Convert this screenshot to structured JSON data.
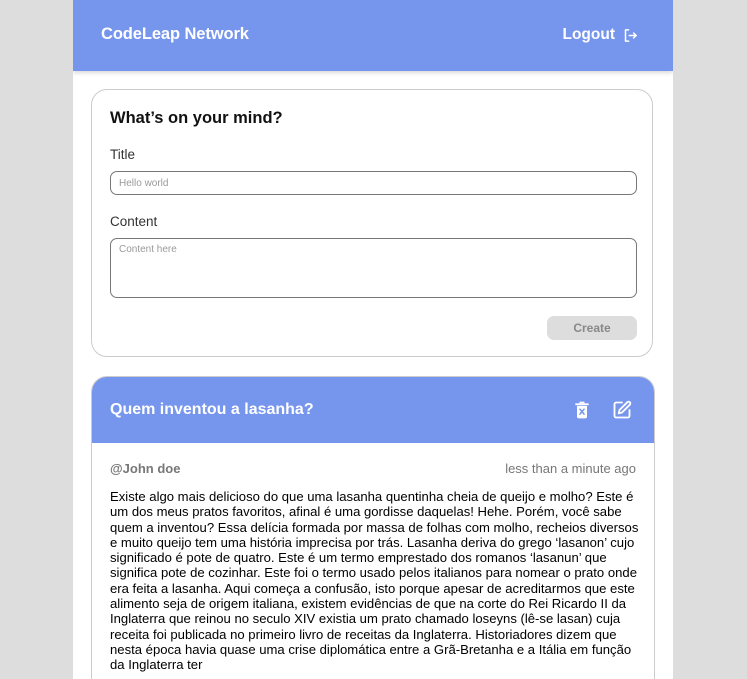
{
  "header": {
    "brand": "CodeLeap Network",
    "logout_label": "Logout"
  },
  "create_form": {
    "heading": "What’s on your mind?",
    "title_label": "Title",
    "title_placeholder": "Hello world",
    "content_label": "Content",
    "content_placeholder": "Content here",
    "create_label": "Create"
  },
  "post": {
    "title": "Quem inventou a lasanha?",
    "author": "@John doe",
    "time": "less than a minute ago",
    "body": "Existe algo mais delicioso do que uma lasanha quentinha cheia de queijo e molho? Este é um dos meus pratos favoritos, afinal é uma gordisse daquelas! Hehe. Porém, você sabe quem a inventou? Essa delícia formada por massa de folhas com molho, recheios diversos e muito queijo tem uma história imprecisa por trás. Lasanha deriva do grego ‘lasanon’ cujo significado é pote de quatro. Este é um termo emprestado dos romanos ‘lasanun’ que significa pote de cozinhar. Este foi o termo usado pelos italianos para nomear o prato onde era feita a lasanha. Aqui começa a confusão, isto porque apesar de acreditarmos que este alimento seja de origem italiana, existem evidências de que na corte do Rei Ricardo II da Inglaterra que reinou no seculo XIV existia um prato chamado loseyns (lê-se lasan) cuja receita foi publicada no primeiro livro de receitas da Inglaterra. Historiadores dizem que nesta época havia quase uma crise diplomática entre a Grã-Bretanha e a Itália em função da Inglaterra ter"
  },
  "colors": {
    "accent": "#7695ec",
    "background": "#dddddd",
    "disabled_button": "#dddddd"
  },
  "icons": {
    "logout": "logout-icon",
    "delete": "trash-icon",
    "edit": "edit-icon"
  }
}
